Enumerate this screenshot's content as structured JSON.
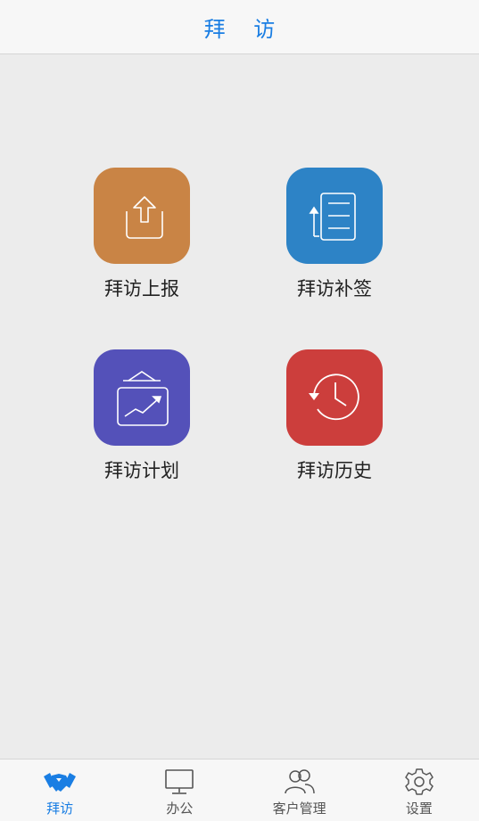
{
  "header": {
    "title": "拜 访"
  },
  "tiles": [
    {
      "label": "拜访上报",
      "icon": "upload-tray-icon",
      "color": "#c98445"
    },
    {
      "label": "拜访补签",
      "icon": "document-list-icon",
      "color": "#2d83c6"
    },
    {
      "label": "拜访计划",
      "icon": "plan-board-chart-icon",
      "color": "#5451b9"
    },
    {
      "label": "拜访历史",
      "icon": "history-clock-icon",
      "color": "#cc3e3c"
    }
  ],
  "tabbar": {
    "active": "拜访",
    "accent": "#1a7ee3",
    "items": [
      {
        "label": "拜访",
        "icon": "handshake-icon"
      },
      {
        "label": "办公",
        "icon": "monitor-icon"
      },
      {
        "label": "客户管理",
        "icon": "users-icon"
      },
      {
        "label": "设置",
        "icon": "gear-icon"
      }
    ]
  }
}
